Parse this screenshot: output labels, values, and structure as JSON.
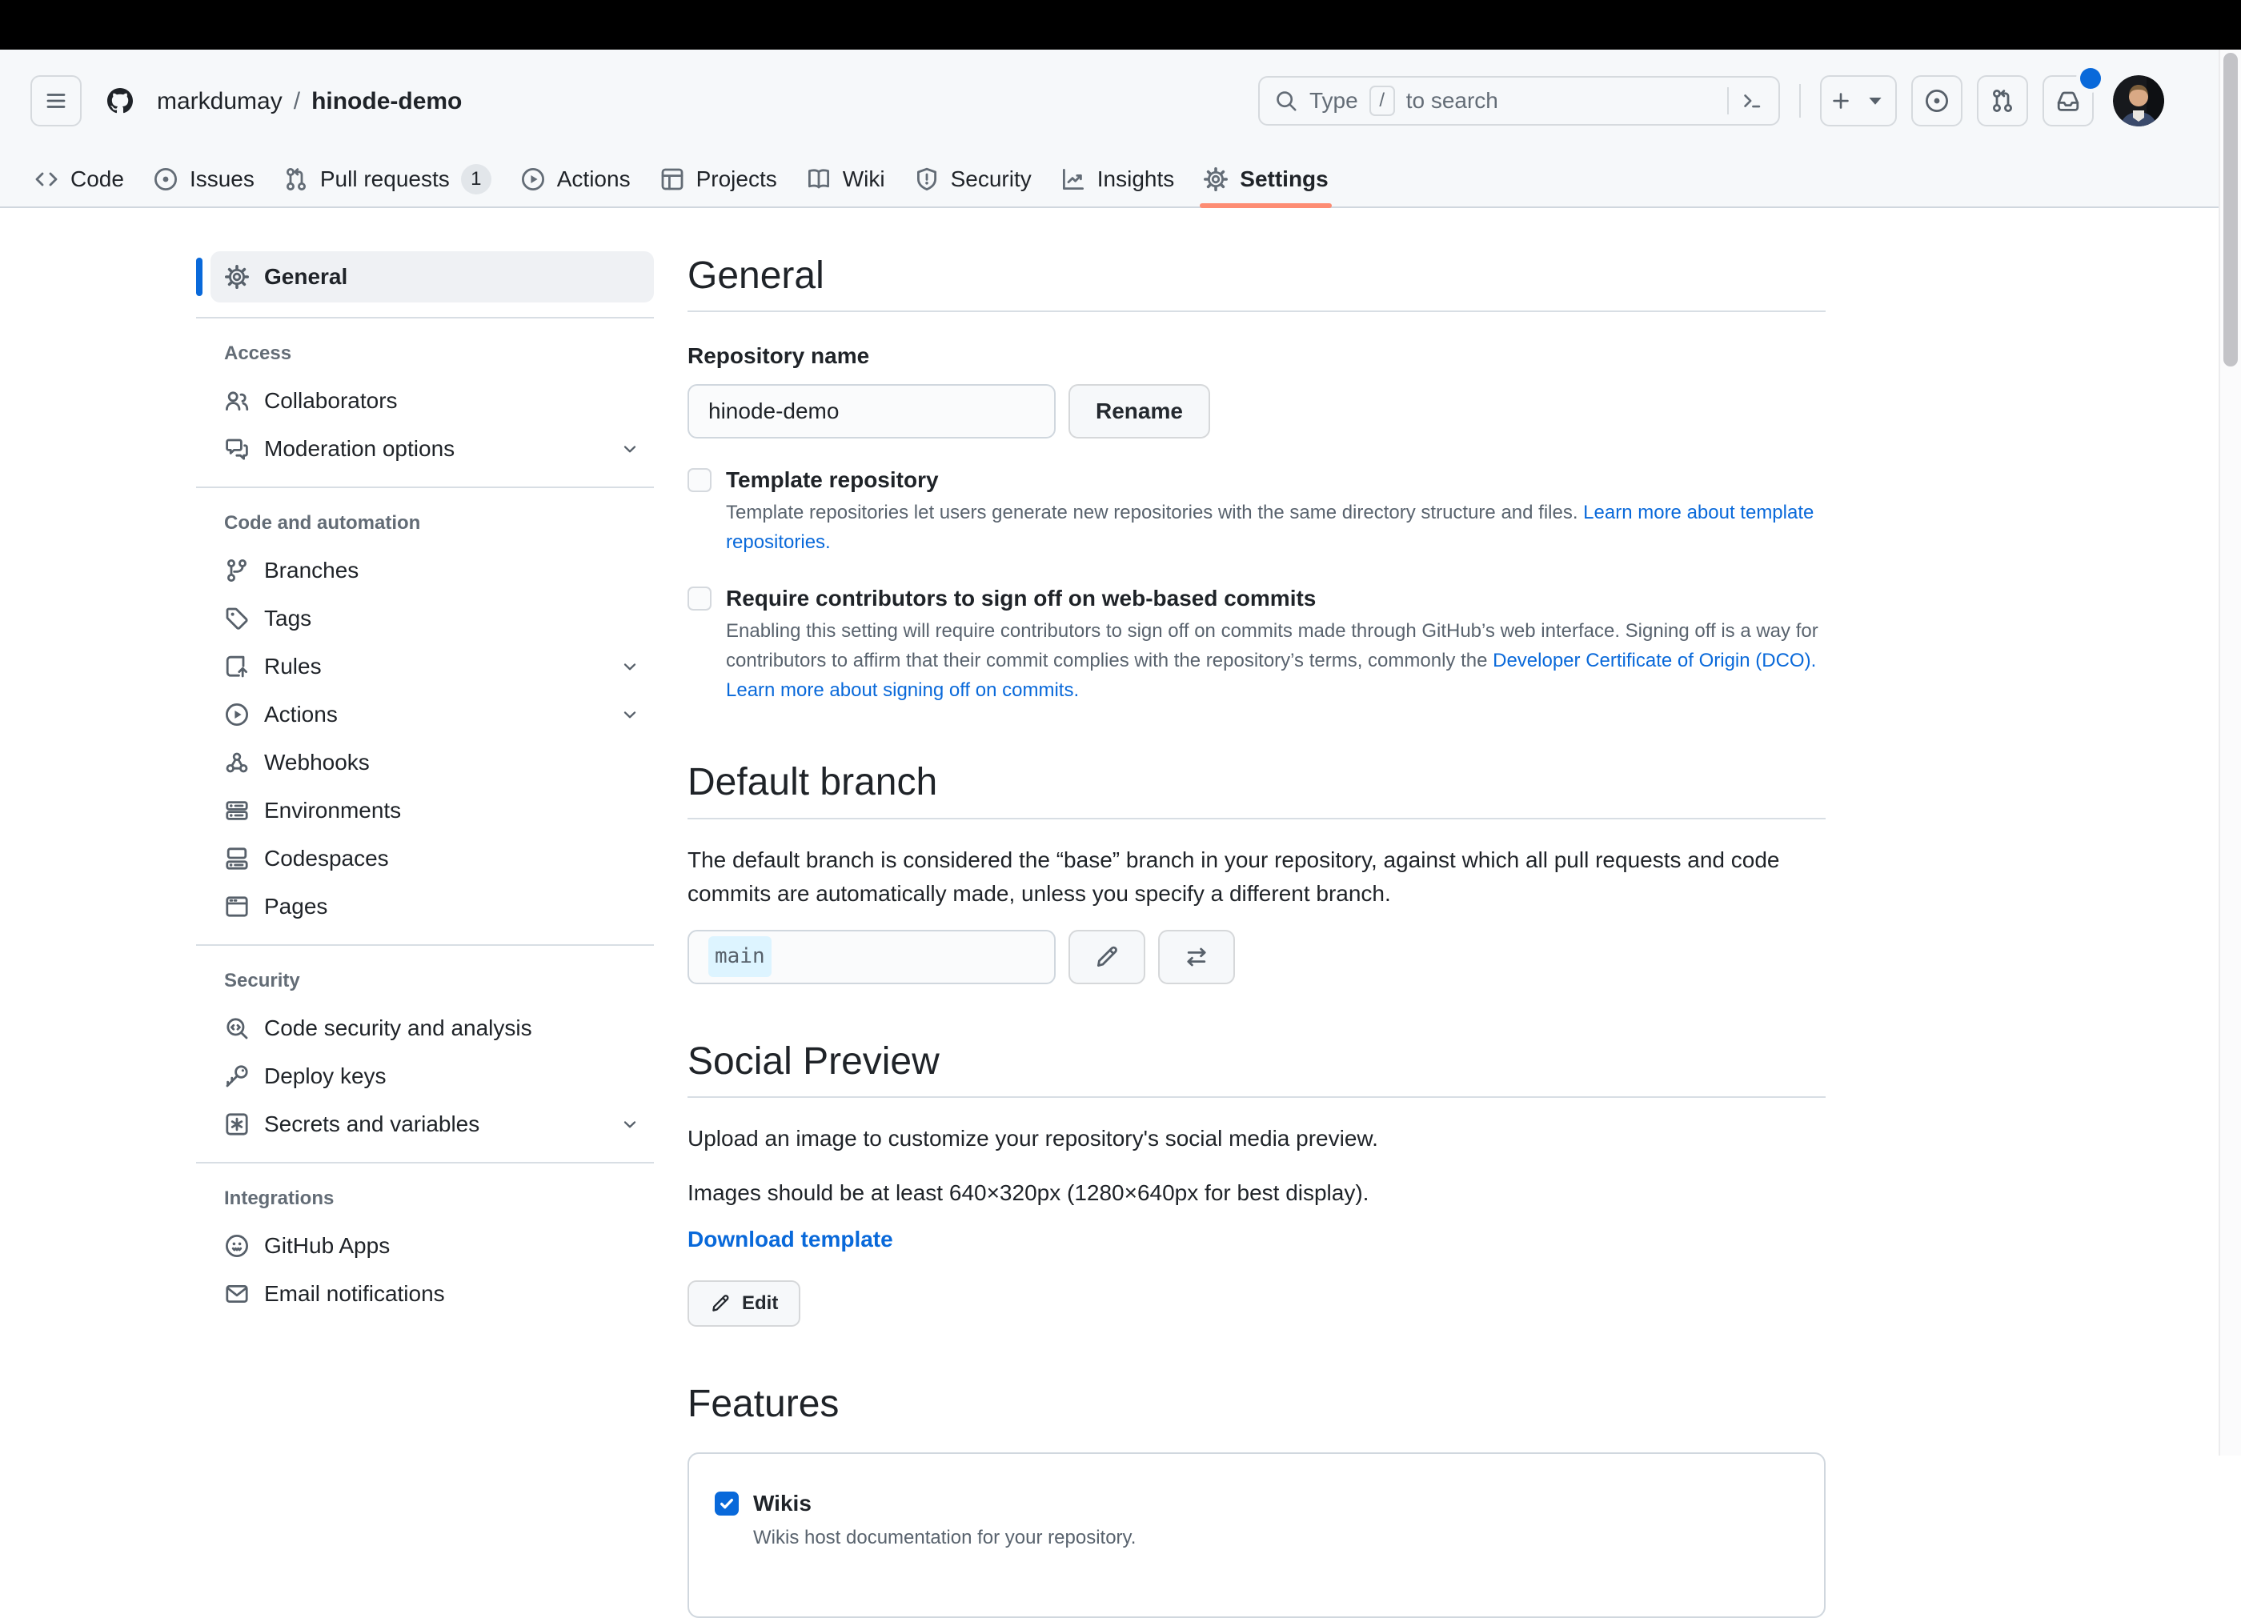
{
  "colors": {
    "accent_blue": "#0969da",
    "nav_underline_coral": "#fd8c73",
    "header_bg": "#f6f8fa",
    "border": "#d0d7de",
    "text": "#1f2328",
    "muted_text": "#59636e",
    "checkbox_checked": "#0969da",
    "branch_highlight": "#ddf4ff",
    "notification_dot": "#0969da"
  },
  "icons": {
    "header": [
      "hamburger-icon",
      "github-logo",
      "search-icon",
      "slash-key",
      "command-palette-icon",
      "plus-icon",
      "caret-down-icon",
      "issue-opened-icon",
      "pull-request-icon",
      "inbox-icon",
      "notification-dot",
      "avatar"
    ],
    "misc": [
      "chevron-down-icon",
      "pencil-icon",
      "arrow-switch-icon",
      "check-icon"
    ]
  },
  "header": {
    "breadcrumb": {
      "owner": "markdumay",
      "separator": "/",
      "repo": "hinode-demo"
    },
    "search": {
      "prefix": "Type",
      "key": "/",
      "suffix": "to search"
    }
  },
  "nav": {
    "tabs": [
      {
        "label": "Code"
      },
      {
        "label": "Issues"
      },
      {
        "label": "Pull requests",
        "badge": "1"
      },
      {
        "label": "Actions"
      },
      {
        "label": "Projects"
      },
      {
        "label": "Wiki"
      },
      {
        "label": "Security"
      },
      {
        "label": "Insights"
      },
      {
        "label": "Settings"
      }
    ]
  },
  "sidebar": {
    "general": "General",
    "sections": [
      {
        "title": "Access",
        "items": [
          {
            "label": "Collaborators"
          },
          {
            "label": "Moderation options"
          }
        ]
      },
      {
        "title": "Code and automation",
        "items": [
          {
            "label": "Branches"
          },
          {
            "label": "Tags"
          },
          {
            "label": "Rules"
          },
          {
            "label": "Actions"
          },
          {
            "label": "Webhooks"
          },
          {
            "label": "Environments"
          },
          {
            "label": "Codespaces"
          },
          {
            "label": "Pages"
          }
        ]
      },
      {
        "title": "Security",
        "items": [
          {
            "label": "Code security and analysis"
          },
          {
            "label": "Deploy keys"
          },
          {
            "label": "Secrets and variables"
          }
        ]
      },
      {
        "title": "Integrations",
        "items": [
          {
            "label": "GitHub Apps"
          },
          {
            "label": "Email notifications"
          }
        ]
      }
    ]
  },
  "main": {
    "general": {
      "title": "General",
      "repo_name_label": "Repository name",
      "repo_name_value": "hinode-demo",
      "rename_button": "Rename",
      "template_label": "Template repository",
      "template_desc": "Template repositories let users generate new repositories with the same directory structure and files. ",
      "template_link": "Learn more about template repositories.",
      "signoff_label": "Require contributors to sign off on web-based commits",
      "signoff_desc": "Enabling this setting will require contributors to sign off on commits made through GitHub’s web interface. Signing off is a way for contributors to affirm that their commit complies with the repository’s terms, commonly the ",
      "signoff_dco_link": "Developer Certificate of Origin (DCO).",
      "signoff_learn_link": "Learn more about signing off on commits."
    },
    "default_branch": {
      "title": "Default branch",
      "desc": "The default branch is considered the “base” branch in your repository, against which all pull requests and code commits are automatically made, unless you specify a different branch.",
      "value": "main"
    },
    "social_preview": {
      "title": "Social Preview",
      "upload_text": "Upload an image to customize your repository's social media preview.",
      "size_text": "Images should be at least 640×320px (1280×640px for best display).",
      "download_link": "Download template",
      "edit_button": "Edit"
    },
    "features": {
      "title": "Features",
      "wikis_label": "Wikis",
      "wikis_desc": "Wikis host documentation for your repository."
    }
  }
}
